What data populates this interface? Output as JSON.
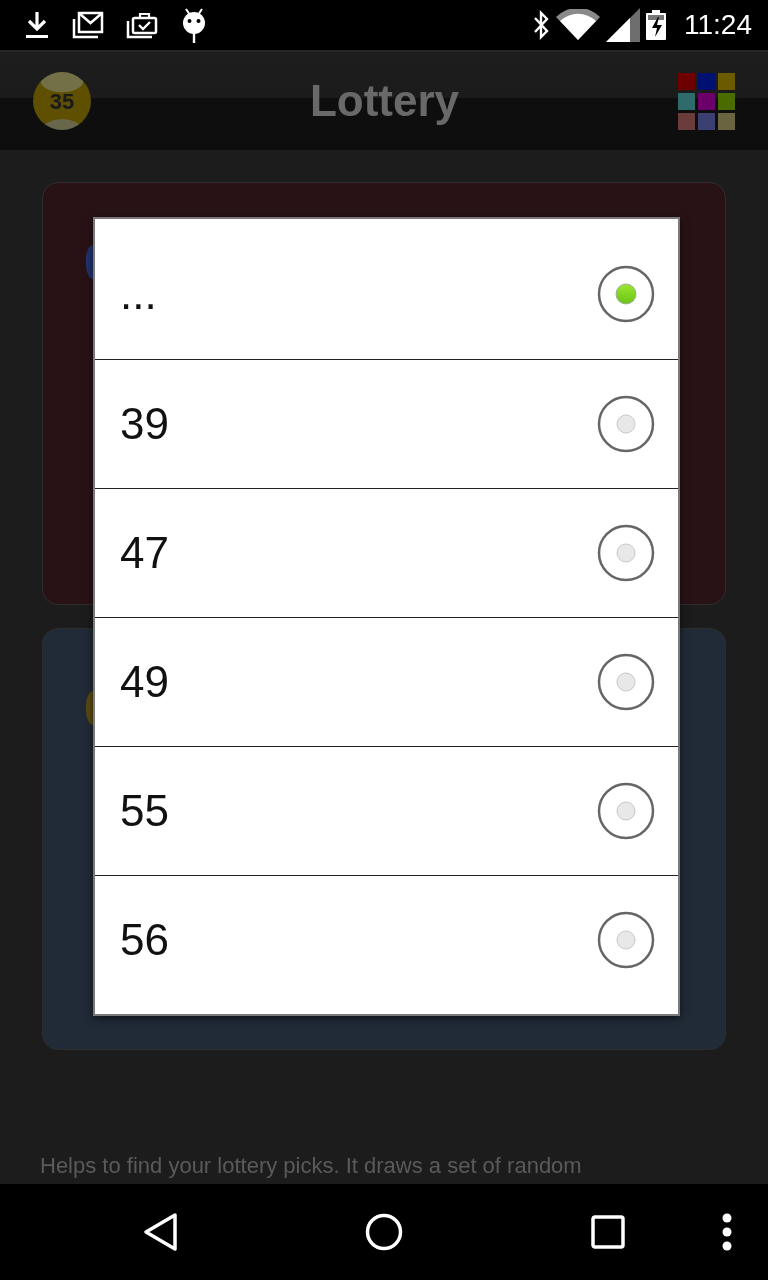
{
  "status_bar": {
    "time": "11:24"
  },
  "app_bar": {
    "ball_number": "35",
    "title": "Lottery"
  },
  "cards": [
    {
      "color": "#291216",
      "ball": {
        "color": "#22346e"
      }
    },
    {
      "color": "#202b37",
      "ball": {
        "color": "#5a4a12"
      }
    }
  ],
  "description": "Helps to find your lottery picks. It draws a set of random",
  "dialog": {
    "options": [
      {
        "label": "...",
        "selected": true
      },
      {
        "label": "39",
        "selected": false
      },
      {
        "label": "47",
        "selected": false
      },
      {
        "label": "49",
        "selected": false
      },
      {
        "label": "55",
        "selected": false
      },
      {
        "label": "56",
        "selected": false
      }
    ]
  }
}
